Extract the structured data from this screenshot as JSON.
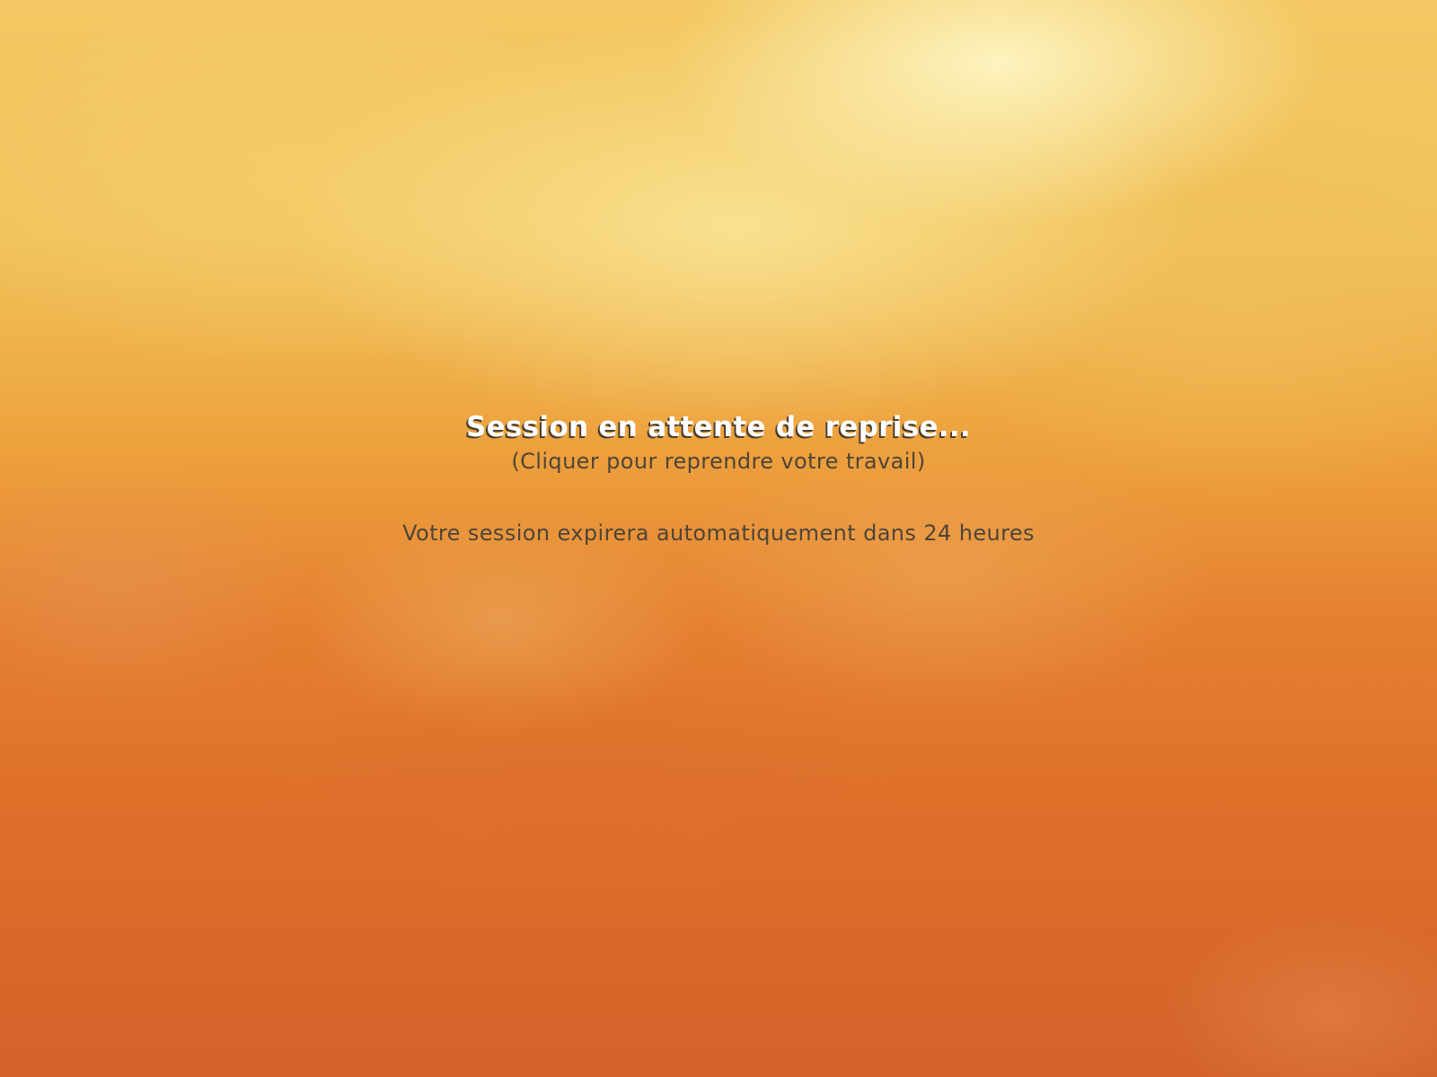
{
  "lock_screen": {
    "title": "Session en attente de reprise...",
    "hint": "(Cliquer pour reprendre votre travail)",
    "expiry_notice": "Votre session expirera automatiquement dans 24 heures"
  },
  "colors": {
    "background_top": "#f3c862",
    "background_bottom": "#d3622a",
    "title_text": "#ffffff",
    "body_text": "#4e4538"
  }
}
